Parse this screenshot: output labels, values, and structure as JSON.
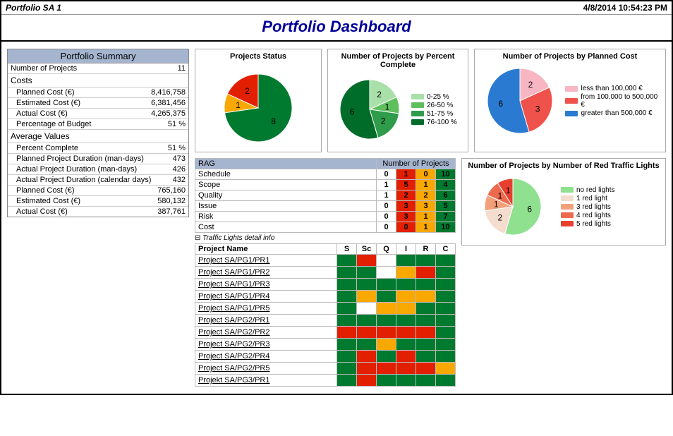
{
  "header": {
    "portfolio_label": "Portfolio SA 1",
    "timestamp": "4/8/2014 10:54:23 PM"
  },
  "title": "Portfolio Dashboard",
  "summary": {
    "title": "Portfolio Summary",
    "num_projects_label": "Number of Projects",
    "num_projects_value": "11",
    "costs_label": "Costs",
    "planned_cost_label": "Planned Cost (€)",
    "planned_cost_value": "8,416,758",
    "estimated_cost_label": "Estimated Cost (€)",
    "estimated_cost_value": "6,381,456",
    "actual_cost_label": "Actual Cost (€)",
    "actual_cost_value": "4,265,375",
    "pct_budget_label": "Percentage of Budget",
    "pct_budget_value": "51 %",
    "avg_label": "Average Values",
    "avg_pct_complete_label": "Percent Complete",
    "avg_pct_complete_value": "51 %",
    "avg_planned_dur_label": "Planned Project Duration (man-days)",
    "avg_planned_dur_value": "473",
    "avg_actual_dur_label": "Actual Project Duration (man-days)",
    "avg_actual_dur_value": "426",
    "avg_actual_cal_label": "Actual Project Duration (calendar days)",
    "avg_actual_cal_value": "432",
    "avg_planned_cost_label": "Planned Cost (€)",
    "avg_planned_cost_value": "765,160",
    "avg_est_cost_label": "Estimated Cost (€)",
    "avg_est_cost_value": "580,132",
    "avg_actual_cost_label": "Actual Cost (€)",
    "avg_actual_cost_value": "387,761"
  },
  "charts": {
    "status_title": "Projects Status",
    "pct_title": "Number of Projects by Percent Complete",
    "cost_title": "Number of Projects by Planned Cost",
    "red_title": "Number of Projects by Number of Red Traffic Lights",
    "pct_legend": {
      "a": "0-25 %",
      "b": "26-50 %",
      "c": "51-75 %",
      "d": "76-100 %"
    },
    "cost_legend": {
      "a": "less than 100,000 €",
      "b": "from 100,000 to 500,000 €",
      "c": "greater than 500,000 €"
    },
    "red_legend": {
      "a": "no red lights",
      "b": "1 red light",
      "c": "3 red lights",
      "d": "4 red lights",
      "e": "5 red lights"
    }
  },
  "rag": {
    "title": "RAG",
    "num_title": "Number of Projects",
    "rows": {
      "schedule": "Schedule",
      "scope": "Scope",
      "quality": "Quality",
      "issue": "Issue",
      "risk": "Risk",
      "cost": "Cost"
    },
    "vals": {
      "schedule": {
        "w": "0",
        "r": "1",
        "a": "0",
        "g": "10"
      },
      "scope": {
        "w": "1",
        "r": "5",
        "a": "1",
        "g": "4"
      },
      "quality": {
        "w": "1",
        "r": "2",
        "a": "2",
        "g": "6"
      },
      "issue": {
        "w": "0",
        "r": "3",
        "a": "3",
        "g": "5"
      },
      "risk": {
        "w": "0",
        "r": "3",
        "a": "1",
        "g": "7"
      },
      "cost": {
        "w": "0",
        "r": "0",
        "a": "1",
        "g": "10"
      }
    }
  },
  "detail": {
    "toggle_label": "Traffic Lights detail info",
    "name_header": "Project Name",
    "cols": {
      "s": "S",
      "sc": "Sc",
      "q": "Q",
      "i": "I",
      "r": "R",
      "c": "C"
    },
    "projects": [
      {
        "name": "Project SA/PG1/PR1",
        "cells": [
          "green",
          "red",
          "white",
          "green",
          "green",
          "green"
        ]
      },
      {
        "name": "Project SA/PG1/PR2",
        "cells": [
          "green",
          "green",
          "white",
          "amber",
          "red",
          "green"
        ]
      },
      {
        "name": "Project SA/PG1/PR3",
        "cells": [
          "green",
          "green",
          "green",
          "green",
          "green",
          "green"
        ]
      },
      {
        "name": "Project SA/PG1/PR4",
        "cells": [
          "green",
          "amber",
          "green",
          "amber",
          "amber",
          "green"
        ]
      },
      {
        "name": "Project SA/PG1/PR5",
        "cells": [
          "green",
          "white",
          "amber",
          "amber",
          "green",
          "green"
        ]
      },
      {
        "name": "Project SA/PG2/PR1",
        "cells": [
          "green",
          "green",
          "green",
          "green",
          "green",
          "green"
        ]
      },
      {
        "name": "Project SA/PG2/PR2",
        "cells": [
          "red",
          "red",
          "red",
          "red",
          "red",
          "green"
        ]
      },
      {
        "name": "Project SA/PG2/PR3",
        "cells": [
          "green",
          "green",
          "amber",
          "green",
          "green",
          "green"
        ]
      },
      {
        "name": "Project SA/PG2/PR4",
        "cells": [
          "green",
          "red",
          "green",
          "red",
          "green",
          "green"
        ]
      },
      {
        "name": "Project SA/PG2/PR5",
        "cells": [
          "green",
          "red",
          "red",
          "red",
          "red",
          "amber"
        ]
      },
      {
        "name": "Projekt SA/PG3/PR1",
        "cells": [
          "green",
          "red",
          "green",
          "green",
          "green",
          "green"
        ]
      }
    ]
  },
  "chart_data": [
    {
      "id": "projects_status",
      "type": "pie",
      "title": "Projects Status",
      "categories": [
        "Green",
        "Amber",
        "Red"
      ],
      "values": [
        8,
        1,
        2
      ],
      "colors": [
        "#007a2f",
        "#f9a800",
        "#e21f00"
      ]
    },
    {
      "id": "pct_complete",
      "type": "pie",
      "title": "Number of Projects by Percent Complete",
      "categories": [
        "0-25 %",
        "26-50 %",
        "51-75 %",
        "76-100 %"
      ],
      "values": [
        2,
        1,
        2,
        6
      ],
      "colors": [
        "#a9dfa9",
        "#5fbf5f",
        "#2e9c4b",
        "#006c2a"
      ]
    },
    {
      "id": "planned_cost",
      "type": "pie",
      "title": "Number of Projects by Planned Cost",
      "categories": [
        "less than 100,000 €",
        "from 100,000 to 500,000 €",
        "greater than 500,000 €"
      ],
      "values": [
        2,
        3,
        6
      ],
      "colors": [
        "#f7b6c2",
        "#ef524b",
        "#2b7ad1"
      ]
    },
    {
      "id": "red_lights",
      "type": "pie",
      "title": "Number of Projects by Number of Red Traffic Lights",
      "categories": [
        "no red lights",
        "1 red light",
        "3 red lights",
        "4 red lights",
        "5 red lights"
      ],
      "values": [
        6,
        2,
        1,
        1,
        1
      ],
      "colors": [
        "#8fe08f",
        "#f4dccf",
        "#f2a07a",
        "#ee6a4e",
        "#e8402f"
      ]
    }
  ]
}
